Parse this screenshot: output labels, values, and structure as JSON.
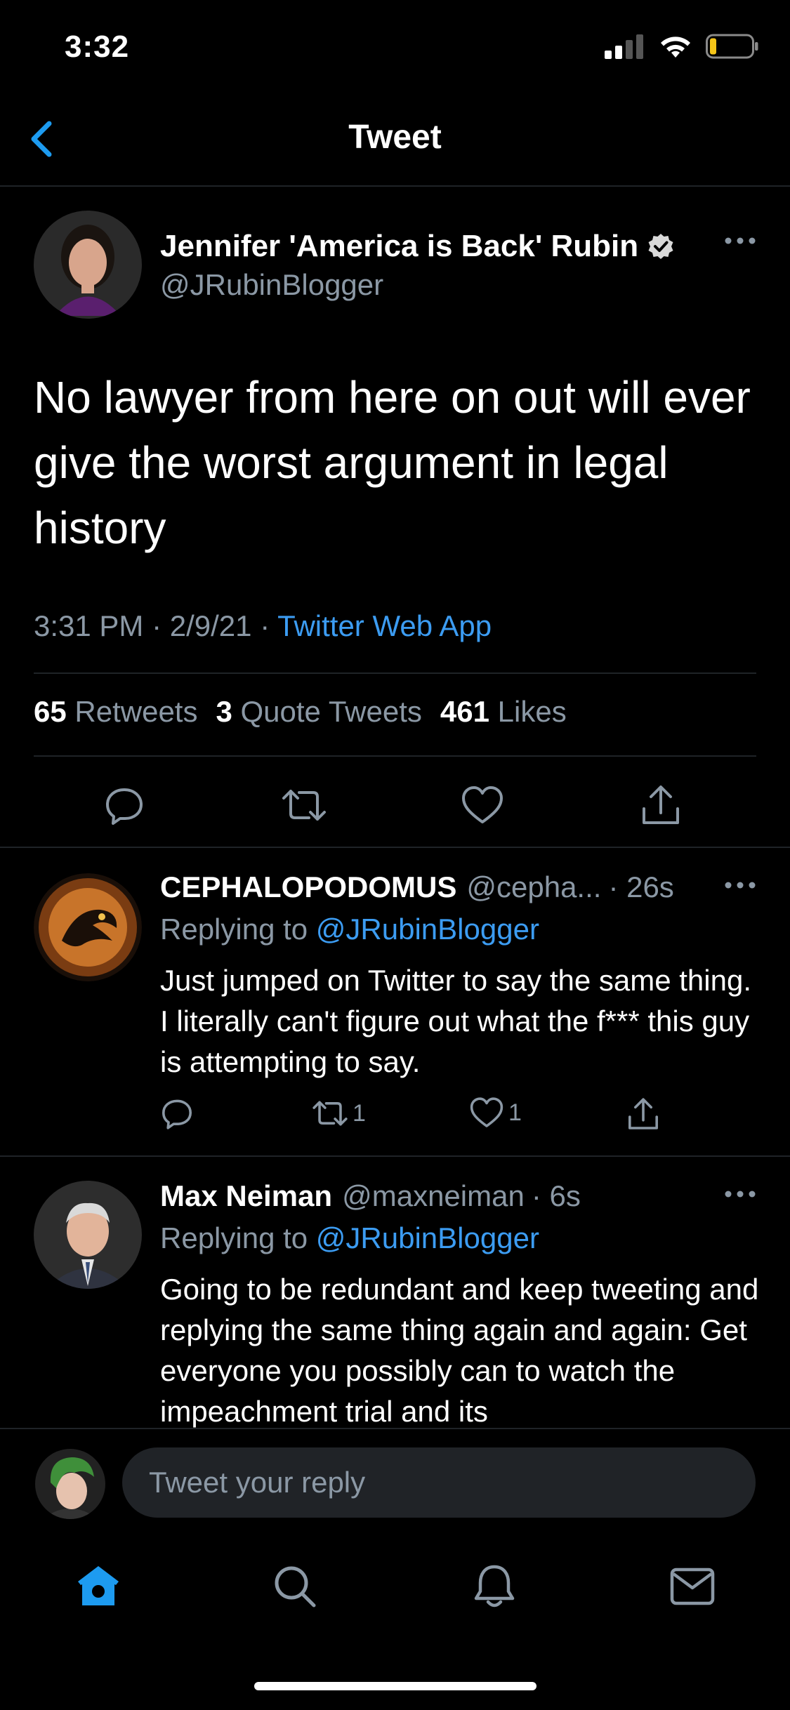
{
  "status_bar": {
    "time": "3:32"
  },
  "header": {
    "title": "Tweet"
  },
  "tweet": {
    "author_name": "Jennifer 'America is Back' Rubin",
    "handle": "@JRubinBlogger",
    "text": "No lawyer from here on out will ever give the worst argument in legal history",
    "time": "3:31 PM",
    "date": "2/9/21",
    "meta_sep": " · ",
    "source": "Twitter Web App",
    "retweets_count": "65",
    "retweets_label": "Retweets",
    "quote_count": "3",
    "quote_label": "Quote Tweets",
    "likes_count": "461",
    "likes_label": "Likes"
  },
  "replies": [
    {
      "name": "CEPHALOPODOMUS",
      "handle": "@cepha...",
      "time": "· 26s",
      "replying_prefix": "Replying to ",
      "replying_to": "@JRubinBlogger",
      "text": "Just jumped on Twitter to say the same thing.  I literally can't figure out what the f*** this guy is attempting to say.",
      "retweets": "1",
      "likes": "1"
    },
    {
      "name": "Max Neiman",
      "handle": "@maxneiman",
      "time": "· 6s",
      "replying_prefix": "Replying to ",
      "replying_to": "@JRubinBlogger",
      "text": "Going to be redundant and keep tweeting and replying the same thing again and again: Get everyone you possibly can to watch the impeachment trial and its"
    }
  ],
  "compose": {
    "placeholder": "Tweet your reply"
  },
  "colors": {
    "accent": "#1d9bf0",
    "link": "#3c9cf2",
    "muted": "#8b98a5",
    "background": "#000000"
  },
  "icons": [
    "back-chevron-icon",
    "verified-badge-icon",
    "more-icon",
    "reply-icon",
    "retweet-icon",
    "like-icon",
    "share-icon",
    "home-icon",
    "search-icon",
    "notifications-icon",
    "messages-icon",
    "signal-icon",
    "wifi-icon",
    "battery-icon"
  ]
}
